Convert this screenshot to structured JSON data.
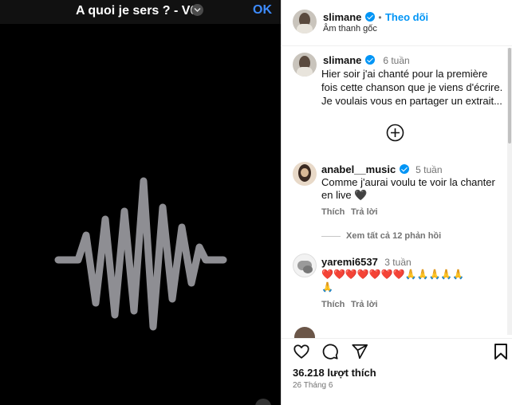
{
  "media": {
    "title": "A quoi je sers ? - V0",
    "ok_label": "OK"
  },
  "header": {
    "username": "slimane",
    "follow_label": "Theo dõi",
    "subtitle": "Âm thanh gốc"
  },
  "caption": {
    "username": "slimane",
    "time": "6 tuần",
    "lines": [
      "Hier soir j'ai chanté pour la première",
      "fois cette chanson que je viens d'écrire.",
      "Je voulais vous en partager un extrait..."
    ]
  },
  "comments": [
    {
      "username": "anabel__music",
      "time": "5 tuần",
      "lines": [
        "Comme j'aurai voulu te voir la chanter",
        "en live 🖤"
      ],
      "like_label": "Thích",
      "reply_label": "Trả lời",
      "view_replies": "Xem tất cả 12 phản hồi"
    },
    {
      "username": "yaremi6537",
      "time": "3 tuần",
      "lines": [
        "❤️❤️❤️❤️❤️❤️❤️🙏🙏🙏🙏🙏",
        "🙏"
      ],
      "like_label": "Thích",
      "reply_label": "Trả lời"
    }
  ],
  "footer": {
    "likes": "36.218 lượt thích",
    "date": "26 Tháng 6"
  },
  "colors": {
    "accent": "#0095f6",
    "waveform": "#8e8e93",
    "ok": "#3d8bfd"
  }
}
